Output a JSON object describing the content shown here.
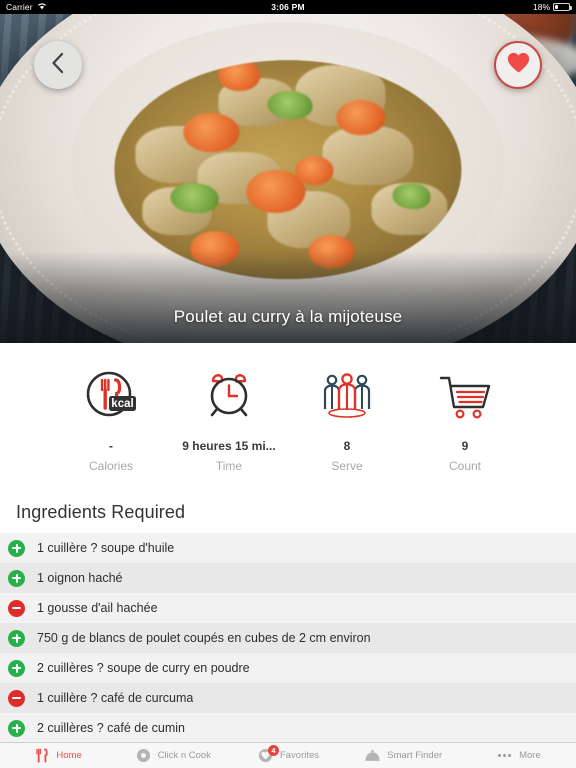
{
  "status_bar": {
    "carrier": "Carrier",
    "wifi_icon": "wifi-icon",
    "time": "3:06 PM",
    "battery_percent": "18%",
    "battery_icon": "battery-icon"
  },
  "hero": {
    "back_icon": "chevron-left-icon",
    "favorite_icon": "heart-icon",
    "recipe_title": "Poulet au curry à la mijoteuse",
    "photo_alt": "chicken-curry-photo"
  },
  "stats": [
    {
      "icon": "calories-kcal-icon",
      "value": "-",
      "label": "Calories"
    },
    {
      "icon": "alarm-clock-icon",
      "value": "9 heures 15 mi...",
      "label": "Time"
    },
    {
      "icon": "people-group-icon",
      "value": "8",
      "label": "Serve"
    },
    {
      "icon": "shopping-cart-icon",
      "value": "9",
      "label": "Count"
    }
  ],
  "ingredients": {
    "heading": "Ingredients Required",
    "items": [
      {
        "action": "add",
        "icon": "plus-circle-icon",
        "text": "1 cuillère ? soupe d'huile"
      },
      {
        "action": "add",
        "icon": "plus-circle-icon",
        "text": "1 oignon haché"
      },
      {
        "action": "remove",
        "icon": "minus-circle-icon",
        "text": "1 gousse d'ail hachée"
      },
      {
        "action": "add",
        "icon": "plus-circle-icon",
        "text": "750 g de blancs de poulet coupés en cubes de 2 cm environ"
      },
      {
        "action": "add",
        "icon": "plus-circle-icon",
        "text": "2 cuillères ? soupe de curry en poudre"
      },
      {
        "action": "remove",
        "icon": "minus-circle-icon",
        "text": "1 cuillère ? café de curcuma"
      },
      {
        "action": "add",
        "icon": "plus-circle-icon",
        "text": "2 cuillères ? café de cumin"
      }
    ]
  },
  "tabbar": {
    "items": [
      {
        "icon": "fork-knife-icon",
        "label": "Home",
        "active": true,
        "badge": ""
      },
      {
        "icon": "click-n-cook-icon",
        "label": "Click n Cook",
        "active": false,
        "badge": ""
      },
      {
        "icon": "heart-circle-icon",
        "label": "Favorites",
        "active": false,
        "badge": "4"
      },
      {
        "icon": "cloche-icon",
        "label": "Smart Finder",
        "active": false,
        "badge": ""
      },
      {
        "icon": "ellipsis-icon",
        "label": "More",
        "active": false,
        "badge": ""
      }
    ]
  },
  "colors": {
    "accent_red": "#e8524a",
    "add_green": "#28b04a",
    "remove_red": "#e02b2b",
    "badge_red": "#e8433c",
    "row_base": "#f2f2f2",
    "row_alt": "#e8e8e8"
  }
}
